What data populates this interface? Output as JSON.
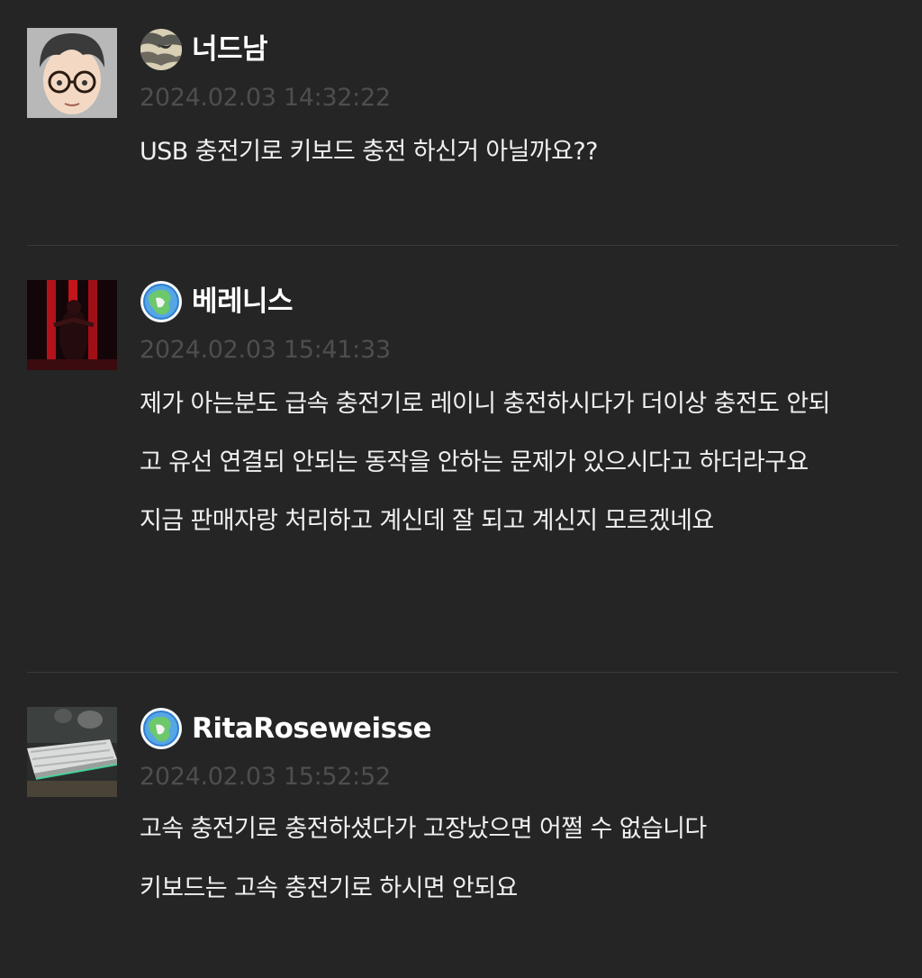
{
  "comments": [
    {
      "avatar": "avatar-cartoon-glasses",
      "level_icon": "camo-sphere-icon",
      "nickname": "너드남",
      "timestamp": "2024.02.03 14:32:22",
      "lines": [
        "USB 충전기로 키보드 충전 하신거 아닐까요??"
      ]
    },
    {
      "avatar": "avatar-dark-red-figure",
      "level_icon": "globe-icon",
      "nickname": "베레니스",
      "timestamp": "2024.02.03 15:41:33",
      "lines": [
        "제가 아는분도 급속 충전기로 레이니 충전하시다가 더이상 충전도 안되",
        "고 유선 연결되 안되는  동작을 안하는 문제가 있으시다고 하더라구요",
        "지금 판매자랑 처리하고 계신데 잘 되고 계신지 모르겠네요"
      ]
    },
    {
      "avatar": "avatar-keyboard-photo",
      "level_icon": "globe-icon",
      "nickname": "RitaRoseweisse",
      "timestamp": "2024.02.03 15:52:52",
      "lines": [
        "고속 충전기로 충전하셨다가 고장났으면 어쩔 수 없습니다",
        "키보드는 고속 충전기로 하시면 안되요"
      ]
    }
  ],
  "colors": {
    "background": "#252526",
    "divider": "#3a3a3c",
    "timestamp": "#4e4e4e",
    "text": "#f0f0f0"
  }
}
